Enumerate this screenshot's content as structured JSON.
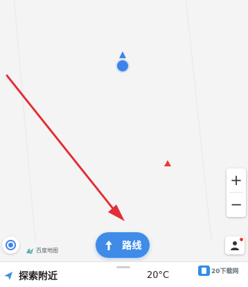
{
  "map": {
    "location_marker": "location-dot",
    "poi_marker": "red-triangle-marker",
    "annotation": "red-arrow"
  },
  "controls": {
    "zoom_in": "+",
    "zoom_out": "−",
    "route_label": "路线",
    "logo_text": "百度地图"
  },
  "bottom_bar": {
    "explore_label": "探索附近",
    "temperature": "20°C",
    "watermark_text": "20下载网"
  },
  "colors": {
    "accent": "#3f8ce8",
    "marker_red": "#ea3b30",
    "arrow_red": "#e42d35"
  }
}
